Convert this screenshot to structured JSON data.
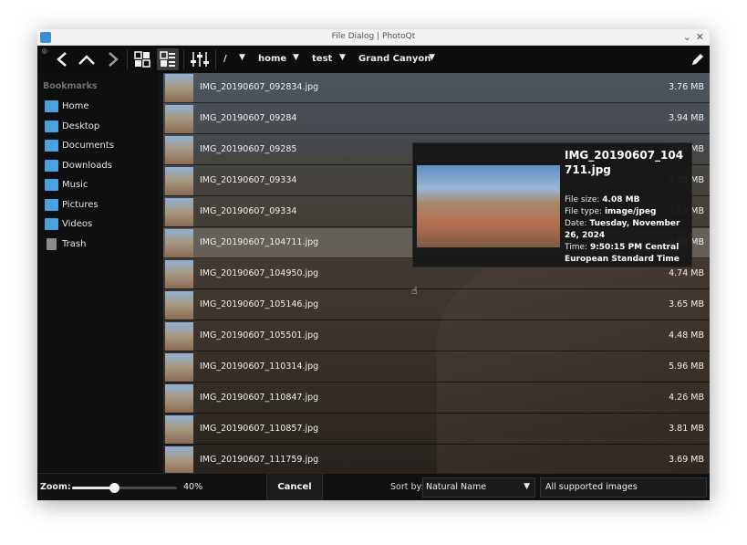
{
  "window": {
    "title": "File Dialog | PhotoQt"
  },
  "toolbar": {
    "back_icon": "chevron-left-icon",
    "up_icon": "chevron-up-icon",
    "forward_icon": "chevron-right-icon",
    "path": [
      {
        "label": "/"
      },
      {
        "label": "home"
      },
      {
        "label": "test"
      },
      {
        "label": "Grand Canyon"
      }
    ]
  },
  "sidebar": {
    "title": "Bookmarks",
    "items": [
      {
        "label": "Home"
      },
      {
        "label": "Desktop"
      },
      {
        "label": "Documents"
      },
      {
        "label": "Downloads"
      },
      {
        "label": "Music"
      },
      {
        "label": "Pictures"
      },
      {
        "label": "Videos"
      },
      {
        "label": "Trash"
      }
    ]
  },
  "files": [
    {
      "name": "IMG_20190607_092834.jpg",
      "size": "3.76 MB"
    },
    {
      "name": "IMG_20190607_09284",
      "size": "3.94 MB"
    },
    {
      "name": "IMG_20190607_09285",
      "size": "3.69 MB"
    },
    {
      "name": "IMG_20190607_09334",
      "size": "3.38 MB"
    },
    {
      "name": "IMG_20190607_09334",
      "size": "3.53 MB"
    },
    {
      "name": "IMG_20190607_104711.jpg",
      "size": "4.08 MB"
    },
    {
      "name": "IMG_20190607_104950.jpg",
      "size": "4.74 MB"
    },
    {
      "name": "IMG_20190607_105146.jpg",
      "size": "3.65 MB"
    },
    {
      "name": "IMG_20190607_105501.jpg",
      "size": "4.48 MB"
    },
    {
      "name": "IMG_20190607_110314.jpg",
      "size": "5.96 MB"
    },
    {
      "name": "IMG_20190607_110847.jpg",
      "size": "4.26 MB"
    },
    {
      "name": "IMG_20190607_110857.jpg",
      "size": "3.81 MB"
    },
    {
      "name": "IMG_20190607_111759.jpg",
      "size": "3.69 MB"
    }
  ],
  "tooltip": {
    "filename": "IMG_20190607_104711.jpg",
    "size_label": "File size:",
    "size_value": "4.08 MB",
    "type_label": "File type:",
    "type_value": "image/jpeg",
    "date_label": "Date:",
    "date_value": "Tuesday, November 26, 2024",
    "time_label": "Time:",
    "time_value": "9:50:15 PM Central European Standard Time"
  },
  "bottom": {
    "zoom_label": "Zoom:",
    "zoom_value": "40%",
    "zoom_fraction": 0.4,
    "cancel_label": "Cancel",
    "sort_label": "Sort by:",
    "sort_value": "Natural Name",
    "filter_value": "All supported images"
  }
}
